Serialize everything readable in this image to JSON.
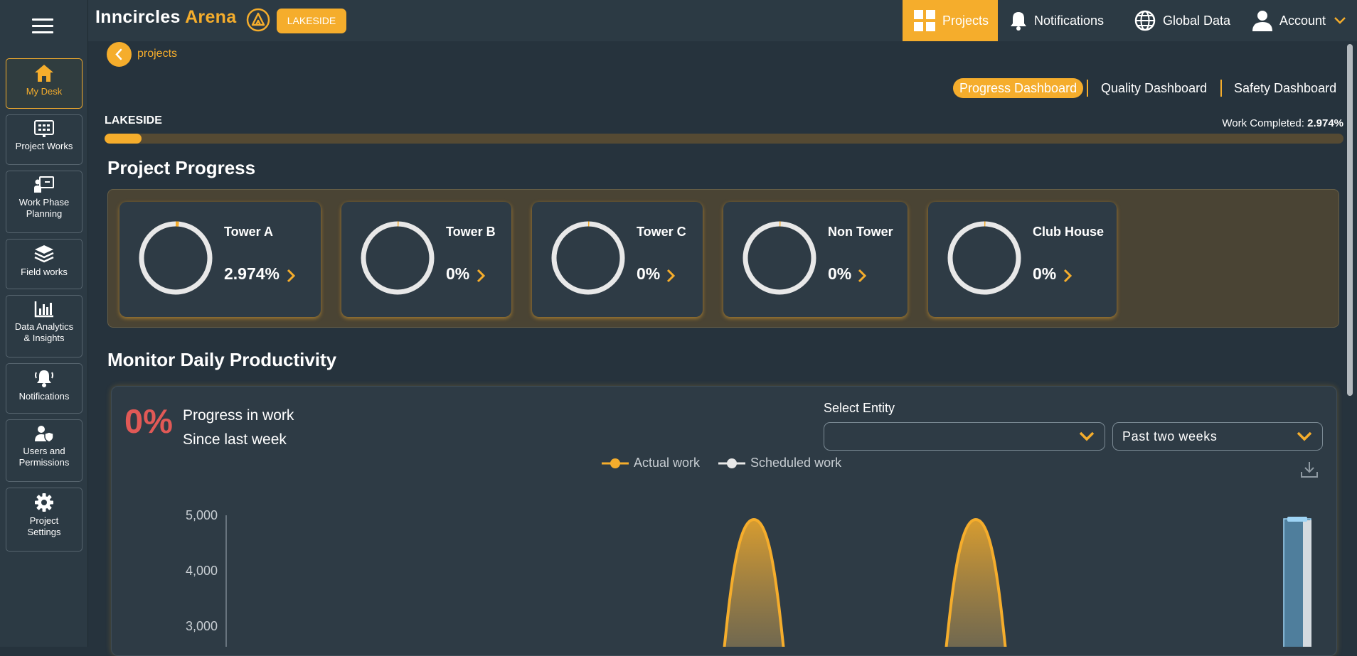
{
  "colors": {
    "accent": "#f5ad2c",
    "negative": "#e15956",
    "sidebar": "#2c3a44",
    "background": "#26333d"
  },
  "sidebar": {
    "menu_icon": "hamburger-icon",
    "items": [
      {
        "label_lines": [
          "My Desk"
        ],
        "icon": "home-icon",
        "active": true
      },
      {
        "label_lines": [
          "Project Works"
        ],
        "icon": "dashboard-board-icon"
      },
      {
        "label_lines": [
          "Work Phase",
          "Planning"
        ],
        "icon": "presenter-board-icon"
      },
      {
        "label_lines": [
          "Field works"
        ],
        "icon": "layers-icon"
      },
      {
        "label_lines": [
          "Data Analytics",
          "& Insights"
        ],
        "icon": "bar-chart-icon"
      },
      {
        "label_lines": [
          "Notifications"
        ],
        "icon": "bell-icon"
      },
      {
        "label_lines": [
          "Users and",
          "Permissions"
        ],
        "icon": "user-shield-icon"
      },
      {
        "label_lines": [
          "Project",
          "Settings"
        ],
        "icon": "gear-icon"
      }
    ]
  },
  "header": {
    "logo_text": "Inncircles",
    "logo_text_accent": "Arena",
    "project_badge": "LAKESIDE",
    "nav": {
      "projects": "Projects",
      "notifications": "Notifications",
      "global_data": "Global Data",
      "account": "Account"
    }
  },
  "breadcrumb": {
    "back_label": "projects"
  },
  "dashboard_tabs": {
    "progress": "Progress Dashboard",
    "quality": "Quality Dashboard",
    "safety": "Safety Dashboard",
    "active": "Progress Dashboard"
  },
  "project": {
    "name": "LAKESIDE",
    "work_completed_label": "Work Completed:",
    "work_completed_value": "2.974%",
    "work_completed_fraction": 0.02974
  },
  "project_progress": {
    "title": "Project Progress",
    "cards": [
      {
        "name": "Tower A",
        "value": "2.974%",
        "percent": 2.974
      },
      {
        "name": "Tower B",
        "value": "0%",
        "percent": 0
      },
      {
        "name": "Tower C",
        "value": "0%",
        "percent": 0
      },
      {
        "name": "Non Tower",
        "value": "0%",
        "percent": 0
      },
      {
        "name": "Club House",
        "value": "0%",
        "percent": 0
      }
    ]
  },
  "productivity": {
    "title": "Monitor Daily Productivity",
    "progress_value": "0%",
    "progress_line1": "Progress in work",
    "progress_line2": "Since last week",
    "select_entity_label": "Select Entity",
    "select_entity_value": "",
    "period_value": "Past two weeks",
    "legend": [
      {
        "label": "Actual work",
        "color": "#f5ad2c"
      },
      {
        "label": "Scheduled work",
        "color": "#e8e8e8"
      }
    ],
    "download_icon": "download-icon"
  },
  "chart_data": {
    "type": "area",
    "y_ticks": [
      "5,000",
      "4,000",
      "3,000"
    ],
    "y_tick_values": [
      5000,
      4000,
      3000
    ],
    "series": [
      {
        "name": "Actual work",
        "peaks": [
          5000,
          5000
        ]
      }
    ]
  }
}
